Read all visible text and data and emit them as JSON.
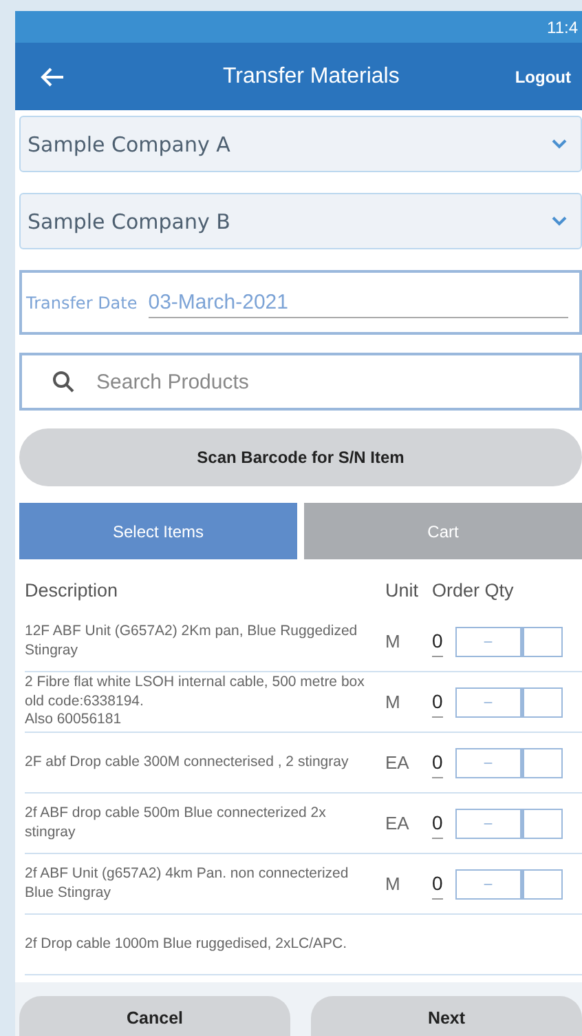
{
  "status_bar": {
    "time": "11:4"
  },
  "app_bar": {
    "title": "Transfer Materials",
    "action": "Logout"
  },
  "dropdowns": [
    {
      "value": "Sample Company A"
    },
    {
      "value": "Sample Company B"
    }
  ],
  "transfer_date": {
    "label": "Transfer Date",
    "value": "03-March-2021"
  },
  "search": {
    "placeholder": "Search Products"
  },
  "scan_button": "Scan Barcode for S/N Item",
  "tabs": [
    {
      "label": "Select Items",
      "selected": true
    },
    {
      "label": "Cart",
      "selected": false
    }
  ],
  "table": {
    "columns": [
      "Description",
      "Unit",
      "Order Qty"
    ],
    "rows": [
      {
        "description": "12F ABF Unit (G657A2) 2Km pan, Blue Ruggedized Stingray",
        "unit": "M",
        "qty": "0",
        "minus": "−"
      },
      {
        "description": "2 Fibre flat white LSOH internal cable, 500 metre box old code:6338194.\nAlso 60056181",
        "unit": "M",
        "qty": "0",
        "minus": "−"
      },
      {
        "description": "2F abf Drop cable 300M connecterised , 2 stingray",
        "unit": "EA",
        "qty": "0",
        "minus": "−"
      },
      {
        "description": "2f ABF drop cable 500m Blue connecterized 2x stingray",
        "unit": "EA",
        "qty": "0",
        "minus": "−"
      },
      {
        "description": "2f ABF Unit (g657A2) 4km Pan. non connecterized Blue Stingray",
        "unit": "M",
        "qty": "0",
        "minus": "−"
      },
      {
        "description": "2f Drop cable 1000m Blue ruggedised, 2xLC/APC."
      }
    ]
  },
  "footer_buttons": [
    "Cancel",
    "Next"
  ]
}
